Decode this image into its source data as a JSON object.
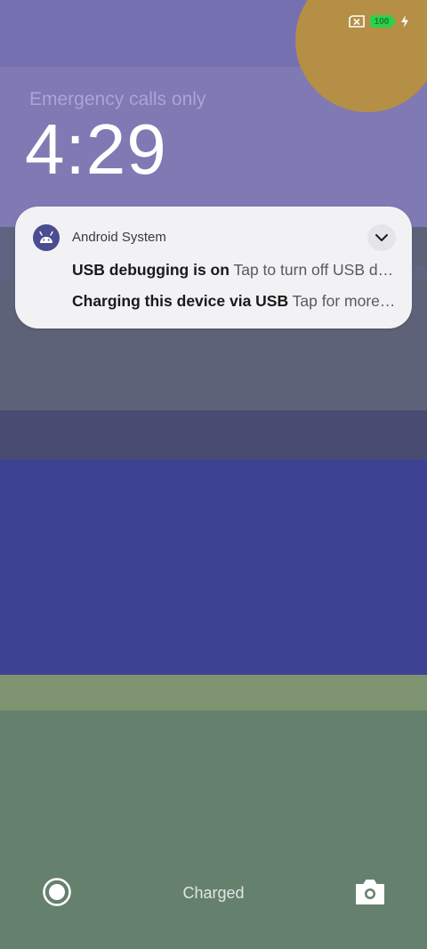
{
  "status_bar": {
    "sim_icon": "no-sim-icon",
    "battery_level": "100",
    "charging_icon": "bolt-icon",
    "battery_color": "#2bd14a"
  },
  "lockscreen": {
    "carrier_text": "Emergency calls only",
    "time": "4:29"
  },
  "notification": {
    "app_name": "Android System",
    "app_icon": "android-robot-icon",
    "expand_icon": "chevron-down-icon",
    "items": [
      {
        "title": "USB debugging is on",
        "text": "Tap to turn off USB debugging."
      },
      {
        "title": "Charging this device via USB",
        "text": "Tap for more options."
      }
    ]
  },
  "bottom": {
    "left_shortcut_icon": "record-icon",
    "status_text": "Charged",
    "right_shortcut_icon": "camera-icon"
  }
}
